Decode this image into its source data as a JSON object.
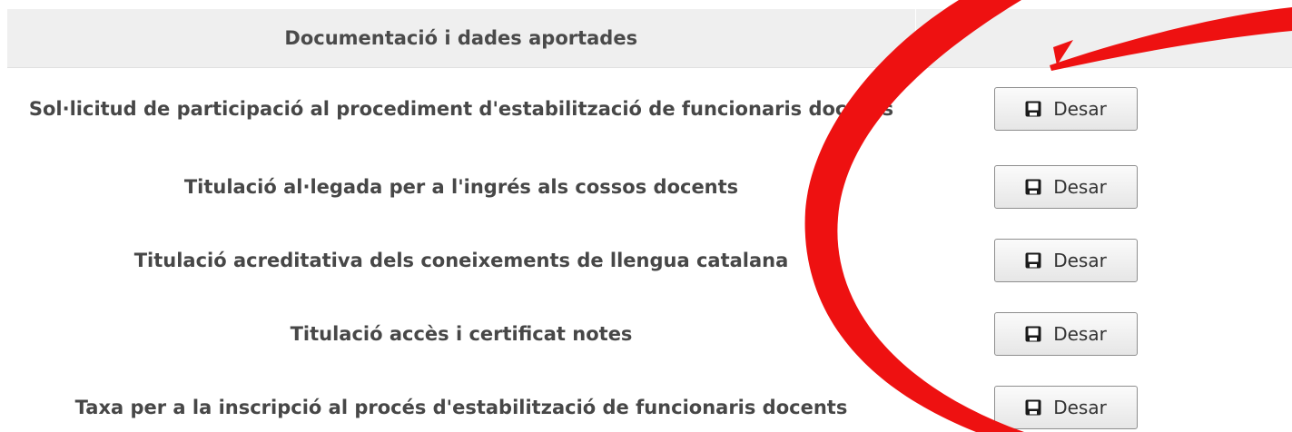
{
  "table": {
    "header_documents": "Documentació i dades aportades",
    "header_actions": "",
    "rows": [
      {
        "label": "Sol·licitud de participació al procediment d'estabilització de funcionaris docents",
        "button": "Desar"
      },
      {
        "label": "Titulació al·legada per a l'ingrés als cossos docents",
        "button": "Desar"
      },
      {
        "label": "Titulació acreditativa dels coneixements de llengua catalana",
        "button": "Desar"
      },
      {
        "label": "Titulació accès i certificat notes",
        "button": "Desar"
      },
      {
        "label": "Taxa per a la inscripció al procés d'estabilització de funcionaris docents",
        "button": "Desar"
      }
    ]
  },
  "icons": {
    "save": "floppy-disk-icon"
  },
  "colors": {
    "header_bg": "#efefef",
    "text": "#474747",
    "annotation": "#ee1111"
  }
}
